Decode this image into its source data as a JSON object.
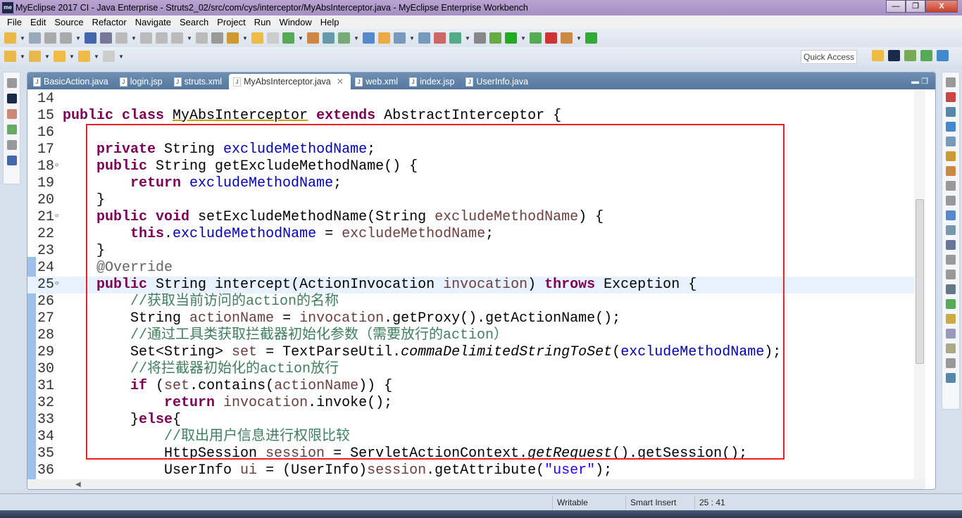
{
  "window": {
    "title": "MyEclipse 2017 CI - Java Enterprise - Struts2_02/src/com/cys/interceptor/MyAbsInterceptor.java - MyEclipse Enterprise Workbench",
    "logo": "me",
    "minimize": "—",
    "restore": "❐",
    "close": "X"
  },
  "menu": [
    "File",
    "Edit",
    "Source",
    "Refactor",
    "Navigate",
    "Search",
    "Project",
    "Run",
    "Window",
    "Help"
  ],
  "quick_access": "Quick Access",
  "tabs": [
    {
      "label": "BasicAction.java",
      "icon": "java-file-icon",
      "active": false
    },
    {
      "label": "login.jsp",
      "icon": "jsp-file-icon",
      "active": false
    },
    {
      "label": "struts.xml",
      "icon": "struts-xml-icon",
      "active": false
    },
    {
      "label": "MyAbsInterceptor.java",
      "icon": "java-file-warning-icon",
      "active": true
    },
    {
      "label": "web.xml",
      "icon": "xml-file-icon",
      "active": false
    },
    {
      "label": "index.jsp",
      "icon": "jsp-file-icon",
      "active": false
    },
    {
      "label": "UserInfo.java",
      "icon": "java-file-icon",
      "active": false
    }
  ],
  "code": [
    {
      "n": "14",
      "t": []
    },
    {
      "n": "15",
      "t": [
        [
          "public class ",
          "k"
        ],
        [
          "MyAbsInterceptor",
          "u"
        ],
        [
          " ",
          ""
        ],
        [
          "extends ",
          "k"
        ],
        [
          "AbstractInterceptor {",
          ""
        ]
      ]
    },
    {
      "n": "16",
      "t": []
    },
    {
      "n": "17",
      "t": [
        [
          "    private ",
          "k"
        ],
        [
          "String ",
          ""
        ],
        [
          "excludeMethodName",
          "f"
        ],
        [
          ";",
          ""
        ]
      ]
    },
    {
      "n": "18",
      "t": [
        [
          "    public ",
          "k"
        ],
        [
          "String getExcludeMethodName() {",
          ""
        ]
      ]
    },
    {
      "n": "19",
      "t": [
        [
          "        return ",
          "k"
        ],
        [
          "excludeMethodName",
          "f"
        ],
        [
          ";",
          ""
        ]
      ]
    },
    {
      "n": "20",
      "t": [
        [
          "    }",
          ""
        ]
      ]
    },
    {
      "n": "21",
      "t": [
        [
          "    public void ",
          "k"
        ],
        [
          "setExcludeMethodName(String ",
          ""
        ],
        [
          "excludeMethodName",
          "p"
        ],
        [
          ") {",
          ""
        ]
      ]
    },
    {
      "n": "22",
      "t": [
        [
          "        this",
          "k"
        ],
        [
          ".",
          ""
        ],
        [
          "excludeMethodName",
          "f"
        ],
        [
          " = ",
          ""
        ],
        [
          "excludeMethodName",
          "p"
        ],
        [
          ";",
          ""
        ]
      ]
    },
    {
      "n": "23",
      "t": [
        [
          "    }",
          ""
        ]
      ]
    },
    {
      "n": "24",
      "t": [
        [
          "    @Override",
          "a"
        ]
      ]
    },
    {
      "n": "25",
      "t": [
        [
          "    public ",
          "k"
        ],
        [
          "String intercept(ActionInvocation ",
          ""
        ],
        [
          "invocation",
          "p"
        ],
        [
          ") ",
          ""
        ],
        [
          "throws ",
          "k"
        ],
        [
          "Exception {",
          ""
        ]
      ]
    },
    {
      "n": "26",
      "t": [
        [
          "        //获取当前访问的action的名称",
          "c"
        ]
      ]
    },
    {
      "n": "27",
      "t": [
        [
          "        String ",
          ""
        ],
        [
          "actionName",
          "p"
        ],
        [
          " = ",
          ""
        ],
        [
          "invocation",
          "p"
        ],
        [
          ".getProxy().getActionName();",
          ""
        ]
      ]
    },
    {
      "n": "28",
      "t": [
        [
          "        //通过工具类获取拦截器初始化参数（需要放行的action）",
          "c"
        ]
      ]
    },
    {
      "n": "29",
      "t": [
        [
          "        Set<String> ",
          ""
        ],
        [
          "set",
          "p"
        ],
        [
          " = TextParseUtil.",
          ""
        ],
        [
          "commaDelimitedStringToSet",
          "i"
        ],
        [
          "(",
          ""
        ],
        [
          "excludeMethodName",
          "f"
        ],
        [
          ");",
          ""
        ]
      ]
    },
    {
      "n": "30",
      "t": [
        [
          "        //将拦截器初始化的action放行",
          "c"
        ]
      ]
    },
    {
      "n": "31",
      "t": [
        [
          "        if ",
          "k"
        ],
        [
          "(",
          ""
        ],
        [
          "set",
          "p"
        ],
        [
          ".contains(",
          ""
        ],
        [
          "actionName",
          "p"
        ],
        [
          ")) {",
          ""
        ]
      ]
    },
    {
      "n": "32",
      "t": [
        [
          "            return ",
          "k"
        ],
        [
          "invocation",
          "p"
        ],
        [
          ".invoke();",
          ""
        ]
      ]
    },
    {
      "n": "33",
      "t": [
        [
          "        }",
          ""
        ],
        [
          "else",
          "k"
        ],
        [
          "{",
          ""
        ]
      ]
    },
    {
      "n": "34",
      "t": [
        [
          "            //取出用户信息进行权限比较",
          "c"
        ]
      ]
    },
    {
      "n": "35",
      "t": [
        [
          "            HttpSession ",
          ""
        ],
        [
          "session",
          "p"
        ],
        [
          " = ServletActionContext.",
          ""
        ],
        [
          "getRequest",
          "i"
        ],
        [
          "().getSession();",
          ""
        ]
      ]
    },
    {
      "n": "36",
      "t": [
        [
          "            UserInfo ",
          ""
        ],
        [
          "ui",
          "p"
        ],
        [
          " = (UserInfo)",
          ""
        ],
        [
          "session",
          "p"
        ],
        [
          ".getAttribute(",
          ""
        ],
        [
          "\"user\"",
          "s"
        ],
        [
          ");",
          ""
        ]
      ]
    }
  ],
  "current_line": "25",
  "status": {
    "writable": "Writable",
    "insert_mode": "Smart Insert",
    "position": "25 : 41"
  },
  "colors": {
    "highlight_box": "#ee2222",
    "keyword": "#7f0055",
    "field": "#0000c0",
    "comment": "#3f7f5f",
    "string": "#2a00ff"
  }
}
